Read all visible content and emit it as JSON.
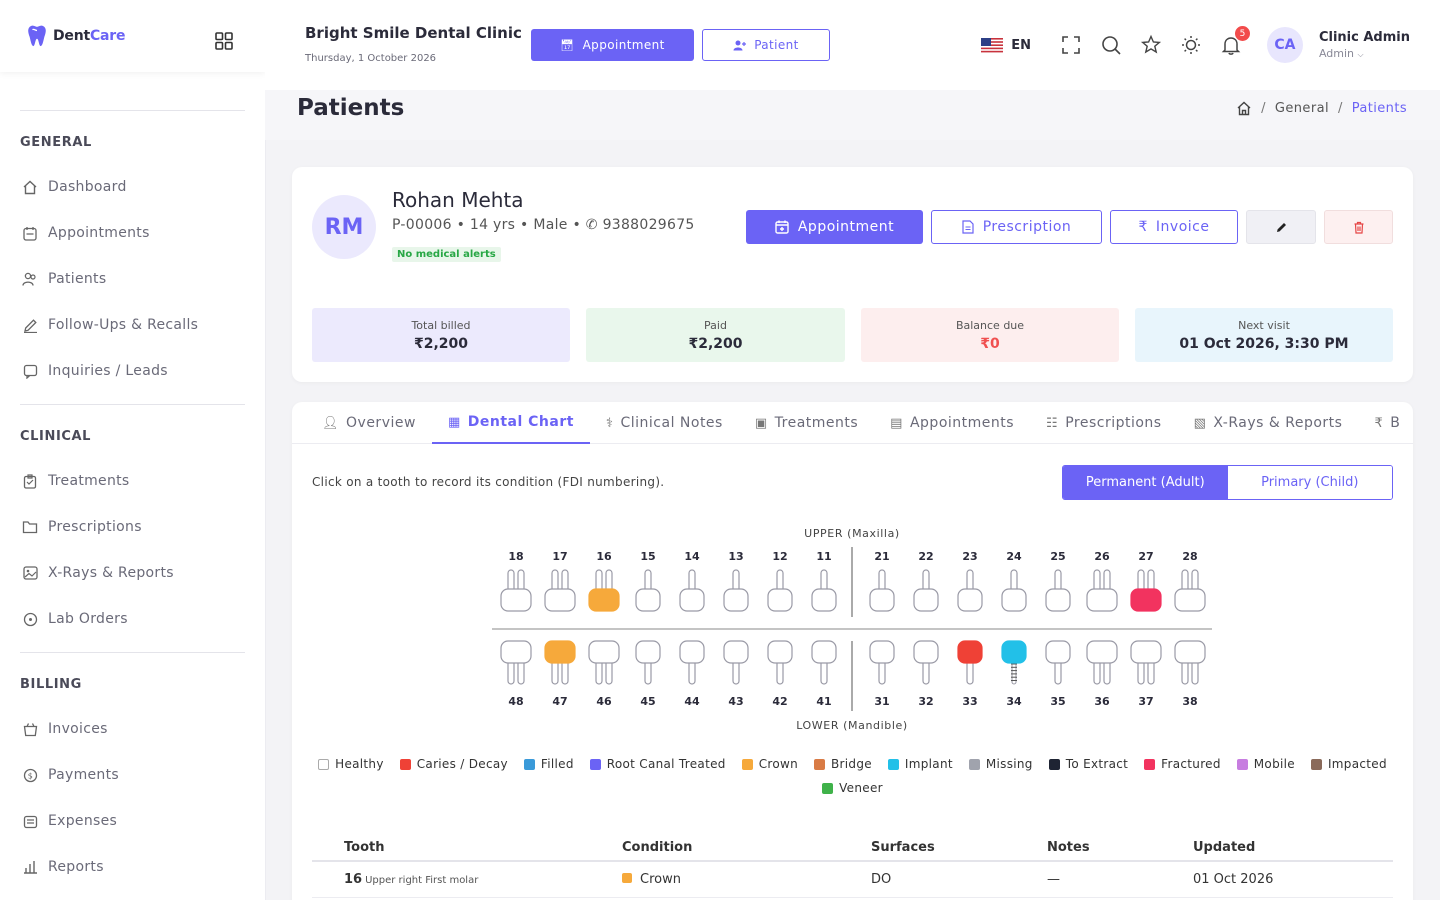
{
  "brand": {
    "name_part1": "Dent",
    "name_part2": "Care"
  },
  "sidebar": {
    "sections": [
      {
        "title": "GENERAL",
        "items": [
          {
            "label": "Dashboard",
            "icon": "home-icon"
          },
          {
            "label": "Appointments",
            "icon": "calendar-icon"
          },
          {
            "label": "Patients",
            "icon": "users-icon"
          },
          {
            "label": "Follow-Ups & Recalls",
            "icon": "pen-icon"
          },
          {
            "label": "Inquiries / Leads",
            "icon": "chat-icon"
          }
        ]
      },
      {
        "title": "CLINICAL",
        "items": [
          {
            "label": "Treatments",
            "icon": "clipboard-icon"
          },
          {
            "label": "Prescriptions",
            "icon": "folder-icon"
          },
          {
            "label": "X-Rays & Reports",
            "icon": "image-icon"
          },
          {
            "label": "Lab Orders",
            "icon": "circle-icon"
          }
        ]
      },
      {
        "title": "BILLING",
        "items": [
          {
            "label": "Invoices",
            "icon": "basket-icon"
          },
          {
            "label": "Payments",
            "icon": "dollar-icon"
          },
          {
            "label": "Expenses",
            "icon": "wallet-icon"
          },
          {
            "label": "Reports",
            "icon": "bar-chart-icon"
          }
        ]
      }
    ]
  },
  "topbar": {
    "clinic_name": "Bright Smile Dental Clinic",
    "date": "Thursday, 1 October 2026",
    "appointment_button": "Appointment",
    "patient_button": "Patient",
    "language": "EN",
    "notification_count": "5",
    "user_initials": "CA",
    "user_name": "Clinic Admin",
    "user_role": "Admin"
  },
  "page": {
    "title": "Patients",
    "breadcrumb": [
      "General",
      "Patients"
    ]
  },
  "patient": {
    "initials": "RM",
    "name": "Rohan Mehta",
    "meta": "P-00006 • 14 yrs • Male • ",
    "phone": "9388029675",
    "alert": "No medical alerts",
    "buttons": {
      "appointment": "Appointment",
      "prescription": "Prescription",
      "invoice": "Invoice"
    },
    "stats": [
      {
        "label": "Total billed",
        "value": "₹2,200"
      },
      {
        "label": "Paid",
        "value": "₹2,200"
      },
      {
        "label": "Balance due",
        "value": "₹0"
      },
      {
        "label": "Next visit",
        "value": "01 Oct 2026, 3:30 PM"
      }
    ]
  },
  "tabs": [
    {
      "label": "Overview",
      "icon": "user-icon"
    },
    {
      "label": "Dental Chart",
      "icon": "grid-icon",
      "active": true
    },
    {
      "label": "Clinical Notes",
      "icon": "stethoscope-icon"
    },
    {
      "label": "Treatments",
      "icon": "briefcase-icon"
    },
    {
      "label": "Appointments",
      "icon": "calendar-icon"
    },
    {
      "label": "Prescriptions",
      "icon": "document-icon"
    },
    {
      "label": "X-Rays & Reports",
      "icon": "image-icon"
    },
    {
      "label": "B",
      "icon": "rupee-icon"
    }
  ],
  "dental_chart": {
    "instruction": "Click on a tooth to record its condition (FDI numbering).",
    "modes": [
      "Permanent (Adult)",
      "Primary (Child)"
    ],
    "upper_label": "UPPER (Maxilla)",
    "lower_label": "LOWER (Mandible)",
    "upper_teeth": [
      {
        "num": "18",
        "roots": 2,
        "condition": "healthy"
      },
      {
        "num": "17",
        "roots": 2,
        "condition": "healthy"
      },
      {
        "num": "16",
        "roots": 2,
        "condition": "crown"
      },
      {
        "num": "15",
        "roots": 1,
        "condition": "healthy"
      },
      {
        "num": "14",
        "roots": 1,
        "condition": "healthy"
      },
      {
        "num": "13",
        "roots": 1,
        "condition": "healthy"
      },
      {
        "num": "12",
        "roots": 1,
        "condition": "healthy"
      },
      {
        "num": "11",
        "roots": 1,
        "condition": "healthy"
      },
      {
        "num": "21",
        "roots": 1,
        "condition": "healthy"
      },
      {
        "num": "22",
        "roots": 1,
        "condition": "healthy"
      },
      {
        "num": "23",
        "roots": 1,
        "condition": "healthy"
      },
      {
        "num": "24",
        "roots": 1,
        "condition": "healthy"
      },
      {
        "num": "25",
        "roots": 1,
        "condition": "healthy"
      },
      {
        "num": "26",
        "roots": 2,
        "condition": "healthy"
      },
      {
        "num": "27",
        "roots": 2,
        "condition": "fractured"
      },
      {
        "num": "28",
        "roots": 2,
        "condition": "healthy"
      }
    ],
    "lower_teeth": [
      {
        "num": "48",
        "roots": 2,
        "condition": "healthy"
      },
      {
        "num": "47",
        "roots": 2,
        "condition": "crown"
      },
      {
        "num": "46",
        "roots": 2,
        "condition": "healthy"
      },
      {
        "num": "45",
        "roots": 1,
        "condition": "healthy"
      },
      {
        "num": "44",
        "roots": 1,
        "condition": "healthy"
      },
      {
        "num": "43",
        "roots": 1,
        "condition": "healthy"
      },
      {
        "num": "42",
        "roots": 1,
        "condition": "healthy"
      },
      {
        "num": "41",
        "roots": 1,
        "condition": "healthy"
      },
      {
        "num": "31",
        "roots": 1,
        "condition": "healthy"
      },
      {
        "num": "32",
        "roots": 1,
        "condition": "healthy"
      },
      {
        "num": "33",
        "roots": 1,
        "condition": "caries"
      },
      {
        "num": "34",
        "roots": 1,
        "condition": "implant"
      },
      {
        "num": "35",
        "roots": 1,
        "condition": "healthy"
      },
      {
        "num": "36",
        "roots": 2,
        "condition": "healthy"
      },
      {
        "num": "37",
        "roots": 2,
        "condition": "healthy"
      },
      {
        "num": "38",
        "roots": 2,
        "condition": "healthy"
      }
    ],
    "legend": [
      {
        "key": "healthy",
        "label": "Healthy",
        "color": "#ffffff"
      },
      {
        "key": "caries",
        "label": "Caries / Decay",
        "color": "#ef4136"
      },
      {
        "key": "filled",
        "label": "Filled",
        "color": "#3a9ad9"
      },
      {
        "key": "rct",
        "label": "Root Canal Treated",
        "color": "#6b63f5"
      },
      {
        "key": "crown",
        "label": "Crown",
        "color": "#f6a93b"
      },
      {
        "key": "bridge",
        "label": "Bridge",
        "color": "#d97b45"
      },
      {
        "key": "implant",
        "label": "Implant",
        "color": "#22c0e8"
      },
      {
        "key": "missing",
        "label": "Missing",
        "color": "#a0a3ad"
      },
      {
        "key": "extract",
        "label": "To Extract",
        "color": "#1e2433"
      },
      {
        "key": "fractured",
        "label": "Fractured",
        "color": "#f2335f"
      },
      {
        "key": "mobile",
        "label": "Mobile",
        "color": "#c77de0"
      },
      {
        "key": "impacted",
        "label": "Impacted",
        "color": "#8a6a5a"
      },
      {
        "key": "veneer",
        "label": "Veneer",
        "color": "#3fb24a"
      }
    ],
    "table": {
      "headers": [
        "Tooth",
        "Condition",
        "Surfaces",
        "Notes",
        "Updated"
      ],
      "rows": [
        {
          "tooth": "16",
          "desc": "Upper right First molar",
          "condition": "Crown",
          "condition_color": "#f6a93b",
          "surfaces": "DO",
          "notes": "—",
          "updated": "01 Oct 2026"
        }
      ]
    }
  }
}
